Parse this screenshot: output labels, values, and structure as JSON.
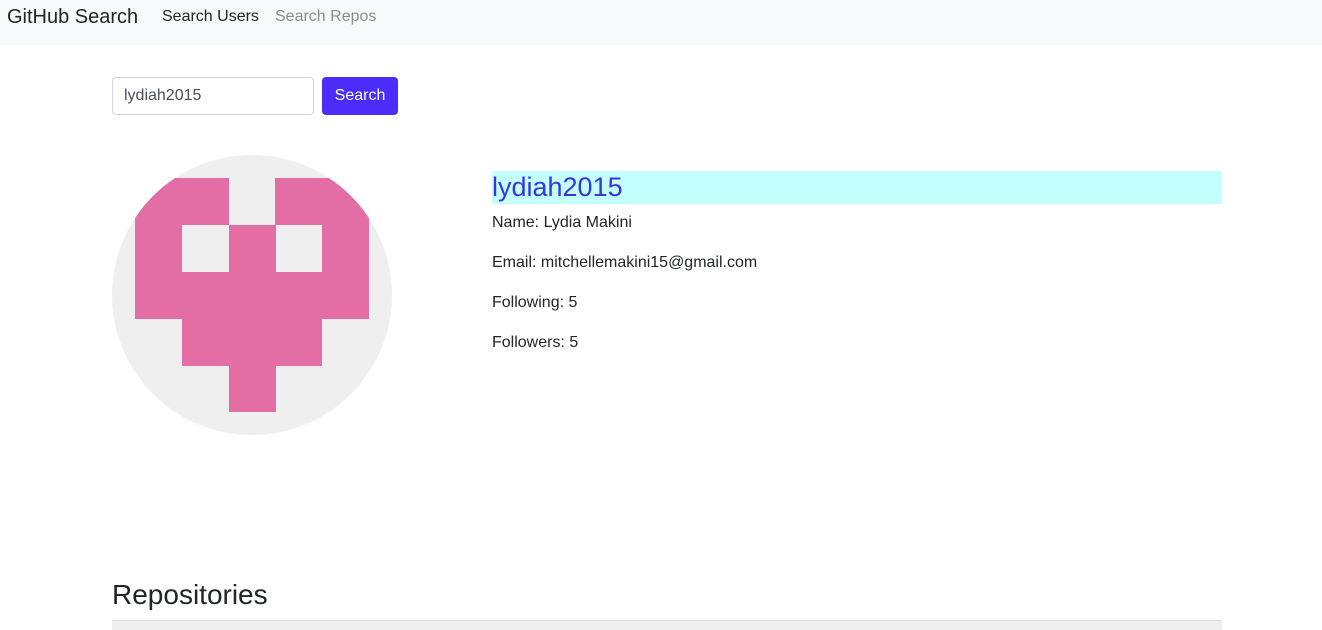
{
  "navbar": {
    "brand": "GitHub Search",
    "links": [
      {
        "label": "Search Users"
      },
      {
        "label": "Search Repos"
      }
    ]
  },
  "search": {
    "value": "lydiah2015",
    "button_label": "Search"
  },
  "profile": {
    "login": "lydiah2015",
    "name_line": "Name: Lydia Makini",
    "email_line": "Email: mitchellemakini15@gmail.com",
    "following_line": "Following: 5",
    "followers_line": "Followers: 5",
    "avatar_icon": "identicon-avatar",
    "avatar_color": "#e36ea6"
  },
  "repositories": {
    "title": "Repositories"
  },
  "colors": {
    "accent": "#4a2dfb",
    "login_highlight": "#c2fffd",
    "login_text": "#3a33e0"
  }
}
